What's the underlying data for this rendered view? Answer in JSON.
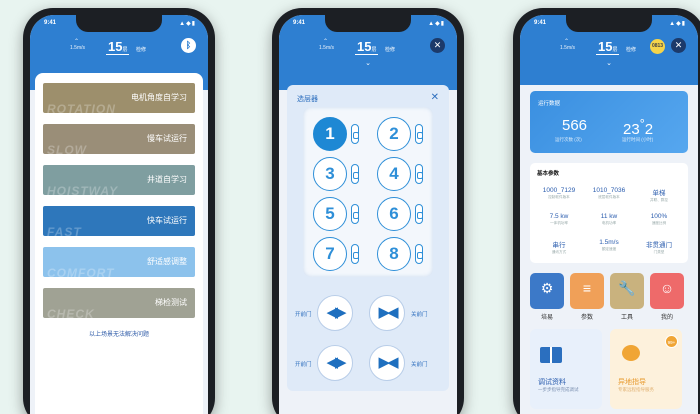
{
  "status_bar": {
    "time": "9:41",
    "signal": "▲◆▮"
  },
  "header": {
    "speed": "1.5m/s",
    "floor": "15",
    "floor_unit": "层",
    "status": "检修",
    "code": "0813"
  },
  "menu": {
    "items": [
      {
        "en": "ROTATION",
        "cn": "电机角度自学习"
      },
      {
        "en": "SLOW",
        "cn": "慢车试运行"
      },
      {
        "en": "HOISTWAY",
        "cn": "井道自学习"
      },
      {
        "en": "FAST",
        "cn": "快车试运行"
      },
      {
        "en": "COMFORT",
        "cn": "舒适感调整"
      },
      {
        "en": "CHECK",
        "cn": "梯检测试"
      }
    ],
    "note": "以上场景无法解决问题"
  },
  "selector": {
    "title": "选层器",
    "close": "✕",
    "floors": [
      "1",
      "2",
      "3",
      "4",
      "5",
      "6",
      "7",
      "8"
    ],
    "active_floor": "1",
    "door_open": "开前门",
    "door_close": "关前门",
    "open_symbol": "◀▶",
    "close_symbol": "▶◀"
  },
  "running": {
    "title": "运行数据",
    "value1": "566",
    "value2": "23",
    "value2_suffix": "°",
    "value2_tail": "2",
    "sub1": "运行次数 (次)",
    "sub2": "运行时间 (小时)"
  },
  "basic": {
    "title": "基本参数",
    "cells": [
      {
        "v": "1000_7129",
        "l": "控制软件版本"
      },
      {
        "v": "1010_7036",
        "l": "底层软件版本"
      },
      {
        "v": "单梯",
        "l": "并联、群控"
      },
      {
        "v": "7.5 kw",
        "l": "一体机功率"
      },
      {
        "v": "11 kw",
        "l": "电机功率"
      },
      {
        "v": "100%",
        "l": "速度比例"
      },
      {
        "v": "串行",
        "l": "通讯方式"
      },
      {
        "v": "1.5m/s",
        "l": "额定速度"
      },
      {
        "v": "非贯通门",
        "l": "门类型"
      }
    ]
  },
  "tools": [
    {
      "label": "培易",
      "icon": "⚙",
      "color": "#3c79c8"
    },
    {
      "label": "参数",
      "icon": "≡",
      "color": "#f0a058"
    },
    {
      "label": "工具",
      "icon": "🔧",
      "color": "#c9b27e"
    },
    {
      "label": "我的",
      "icon": "☺",
      "color": "#ee6a6a"
    }
  ],
  "cards": [
    {
      "title": "调试资料",
      "sub": "一步步指导完成调试"
    },
    {
      "title": "异地指导",
      "sub": "专家远程指导服务",
      "badge": "99+"
    }
  ]
}
